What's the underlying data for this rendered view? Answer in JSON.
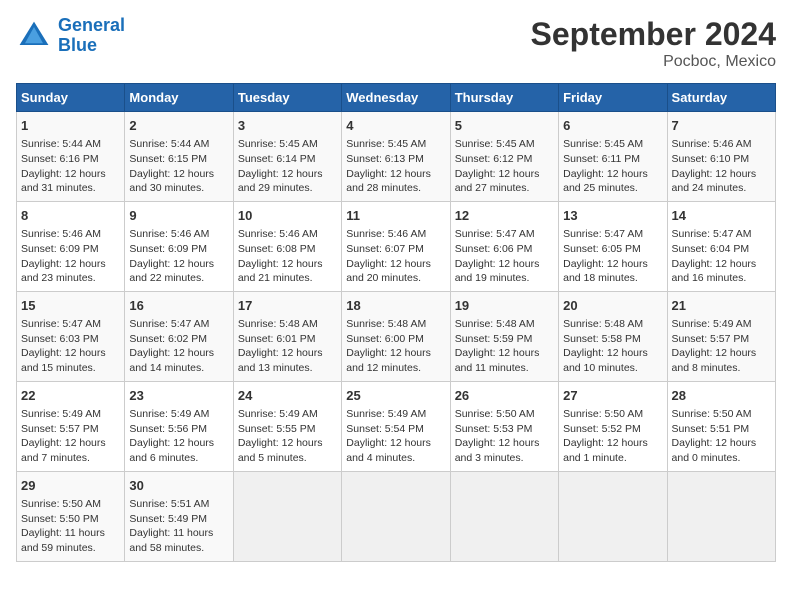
{
  "header": {
    "logo_line1": "General",
    "logo_line2": "Blue",
    "title": "September 2024",
    "subtitle": "Pocboc, Mexico"
  },
  "columns": [
    "Sunday",
    "Monday",
    "Tuesday",
    "Wednesday",
    "Thursday",
    "Friday",
    "Saturday"
  ],
  "weeks": [
    [
      {
        "day": "1",
        "lines": [
          "Sunrise: 5:44 AM",
          "Sunset: 6:16 PM",
          "Daylight: 12 hours",
          "and 31 minutes."
        ]
      },
      {
        "day": "2",
        "lines": [
          "Sunrise: 5:44 AM",
          "Sunset: 6:15 PM",
          "Daylight: 12 hours",
          "and 30 minutes."
        ]
      },
      {
        "day": "3",
        "lines": [
          "Sunrise: 5:45 AM",
          "Sunset: 6:14 PM",
          "Daylight: 12 hours",
          "and 29 minutes."
        ]
      },
      {
        "day": "4",
        "lines": [
          "Sunrise: 5:45 AM",
          "Sunset: 6:13 PM",
          "Daylight: 12 hours",
          "and 28 minutes."
        ]
      },
      {
        "day": "5",
        "lines": [
          "Sunrise: 5:45 AM",
          "Sunset: 6:12 PM",
          "Daylight: 12 hours",
          "and 27 minutes."
        ]
      },
      {
        "day": "6",
        "lines": [
          "Sunrise: 5:45 AM",
          "Sunset: 6:11 PM",
          "Daylight: 12 hours",
          "and 25 minutes."
        ]
      },
      {
        "day": "7",
        "lines": [
          "Sunrise: 5:46 AM",
          "Sunset: 6:10 PM",
          "Daylight: 12 hours",
          "and 24 minutes."
        ]
      }
    ],
    [
      {
        "day": "8",
        "lines": [
          "Sunrise: 5:46 AM",
          "Sunset: 6:09 PM",
          "Daylight: 12 hours",
          "and 23 minutes."
        ]
      },
      {
        "day": "9",
        "lines": [
          "Sunrise: 5:46 AM",
          "Sunset: 6:09 PM",
          "Daylight: 12 hours",
          "and 22 minutes."
        ]
      },
      {
        "day": "10",
        "lines": [
          "Sunrise: 5:46 AM",
          "Sunset: 6:08 PM",
          "Daylight: 12 hours",
          "and 21 minutes."
        ]
      },
      {
        "day": "11",
        "lines": [
          "Sunrise: 5:46 AM",
          "Sunset: 6:07 PM",
          "Daylight: 12 hours",
          "and 20 minutes."
        ]
      },
      {
        "day": "12",
        "lines": [
          "Sunrise: 5:47 AM",
          "Sunset: 6:06 PM",
          "Daylight: 12 hours",
          "and 19 minutes."
        ]
      },
      {
        "day": "13",
        "lines": [
          "Sunrise: 5:47 AM",
          "Sunset: 6:05 PM",
          "Daylight: 12 hours",
          "and 18 minutes."
        ]
      },
      {
        "day": "14",
        "lines": [
          "Sunrise: 5:47 AM",
          "Sunset: 6:04 PM",
          "Daylight: 12 hours",
          "and 16 minutes."
        ]
      }
    ],
    [
      {
        "day": "15",
        "lines": [
          "Sunrise: 5:47 AM",
          "Sunset: 6:03 PM",
          "Daylight: 12 hours",
          "and 15 minutes."
        ]
      },
      {
        "day": "16",
        "lines": [
          "Sunrise: 5:47 AM",
          "Sunset: 6:02 PM",
          "Daylight: 12 hours",
          "and 14 minutes."
        ]
      },
      {
        "day": "17",
        "lines": [
          "Sunrise: 5:48 AM",
          "Sunset: 6:01 PM",
          "Daylight: 12 hours",
          "and 13 minutes."
        ]
      },
      {
        "day": "18",
        "lines": [
          "Sunrise: 5:48 AM",
          "Sunset: 6:00 PM",
          "Daylight: 12 hours",
          "and 12 minutes."
        ]
      },
      {
        "day": "19",
        "lines": [
          "Sunrise: 5:48 AM",
          "Sunset: 5:59 PM",
          "Daylight: 12 hours",
          "and 11 minutes."
        ]
      },
      {
        "day": "20",
        "lines": [
          "Sunrise: 5:48 AM",
          "Sunset: 5:58 PM",
          "Daylight: 12 hours",
          "and 10 minutes."
        ]
      },
      {
        "day": "21",
        "lines": [
          "Sunrise: 5:49 AM",
          "Sunset: 5:57 PM",
          "Daylight: 12 hours",
          "and 8 minutes."
        ]
      }
    ],
    [
      {
        "day": "22",
        "lines": [
          "Sunrise: 5:49 AM",
          "Sunset: 5:57 PM",
          "Daylight: 12 hours",
          "and 7 minutes."
        ]
      },
      {
        "day": "23",
        "lines": [
          "Sunrise: 5:49 AM",
          "Sunset: 5:56 PM",
          "Daylight: 12 hours",
          "and 6 minutes."
        ]
      },
      {
        "day": "24",
        "lines": [
          "Sunrise: 5:49 AM",
          "Sunset: 5:55 PM",
          "Daylight: 12 hours",
          "and 5 minutes."
        ]
      },
      {
        "day": "25",
        "lines": [
          "Sunrise: 5:49 AM",
          "Sunset: 5:54 PM",
          "Daylight: 12 hours",
          "and 4 minutes."
        ]
      },
      {
        "day": "26",
        "lines": [
          "Sunrise: 5:50 AM",
          "Sunset: 5:53 PM",
          "Daylight: 12 hours",
          "and 3 minutes."
        ]
      },
      {
        "day": "27",
        "lines": [
          "Sunrise: 5:50 AM",
          "Sunset: 5:52 PM",
          "Daylight: 12 hours",
          "and 1 minute."
        ]
      },
      {
        "day": "28",
        "lines": [
          "Sunrise: 5:50 AM",
          "Sunset: 5:51 PM",
          "Daylight: 12 hours",
          "and 0 minutes."
        ]
      }
    ],
    [
      {
        "day": "29",
        "lines": [
          "Sunrise: 5:50 AM",
          "Sunset: 5:50 PM",
          "Daylight: 11 hours",
          "and 59 minutes."
        ]
      },
      {
        "day": "30",
        "lines": [
          "Sunrise: 5:51 AM",
          "Sunset: 5:49 PM",
          "Daylight: 11 hours",
          "and 58 minutes."
        ]
      },
      {
        "day": "",
        "lines": []
      },
      {
        "day": "",
        "lines": []
      },
      {
        "day": "",
        "lines": []
      },
      {
        "day": "",
        "lines": []
      },
      {
        "day": "",
        "lines": []
      }
    ]
  ]
}
